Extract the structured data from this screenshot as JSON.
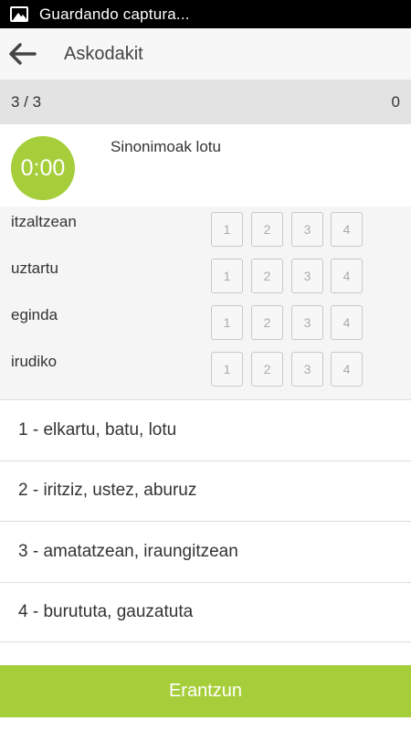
{
  "status_bar": {
    "icon": "image-icon",
    "text": "Guardando captura..."
  },
  "app_bar": {
    "back_icon": "arrow-left-icon",
    "title": "Askodakit"
  },
  "progress": {
    "counter": "3 / 3",
    "score": "0"
  },
  "question": {
    "timer": "0:00",
    "prompt": "Sinonimoak lotu"
  },
  "match_rows": [
    {
      "word": "itzaltzean",
      "options": [
        "1",
        "2",
        "3",
        "4"
      ]
    },
    {
      "word": "uztartu",
      "options": [
        "1",
        "2",
        "3",
        "4"
      ]
    },
    {
      "word": "eginda",
      "options": [
        "1",
        "2",
        "3",
        "4"
      ]
    },
    {
      "word": "irudiko",
      "options": [
        "1",
        "2",
        "3",
        "4"
      ]
    }
  ],
  "answers": [
    "1 - elkartu, batu, lotu",
    "2 - iritziz, ustez, aburuz",
    "3 - amatatzean, iraungitzean",
    "4 - burututa, gauzatuta"
  ],
  "submit_label": "Erantzun",
  "colors": {
    "accent": "#a6cd3a",
    "progress_bg": "#e3e3e3",
    "status_bg": "#000000"
  }
}
